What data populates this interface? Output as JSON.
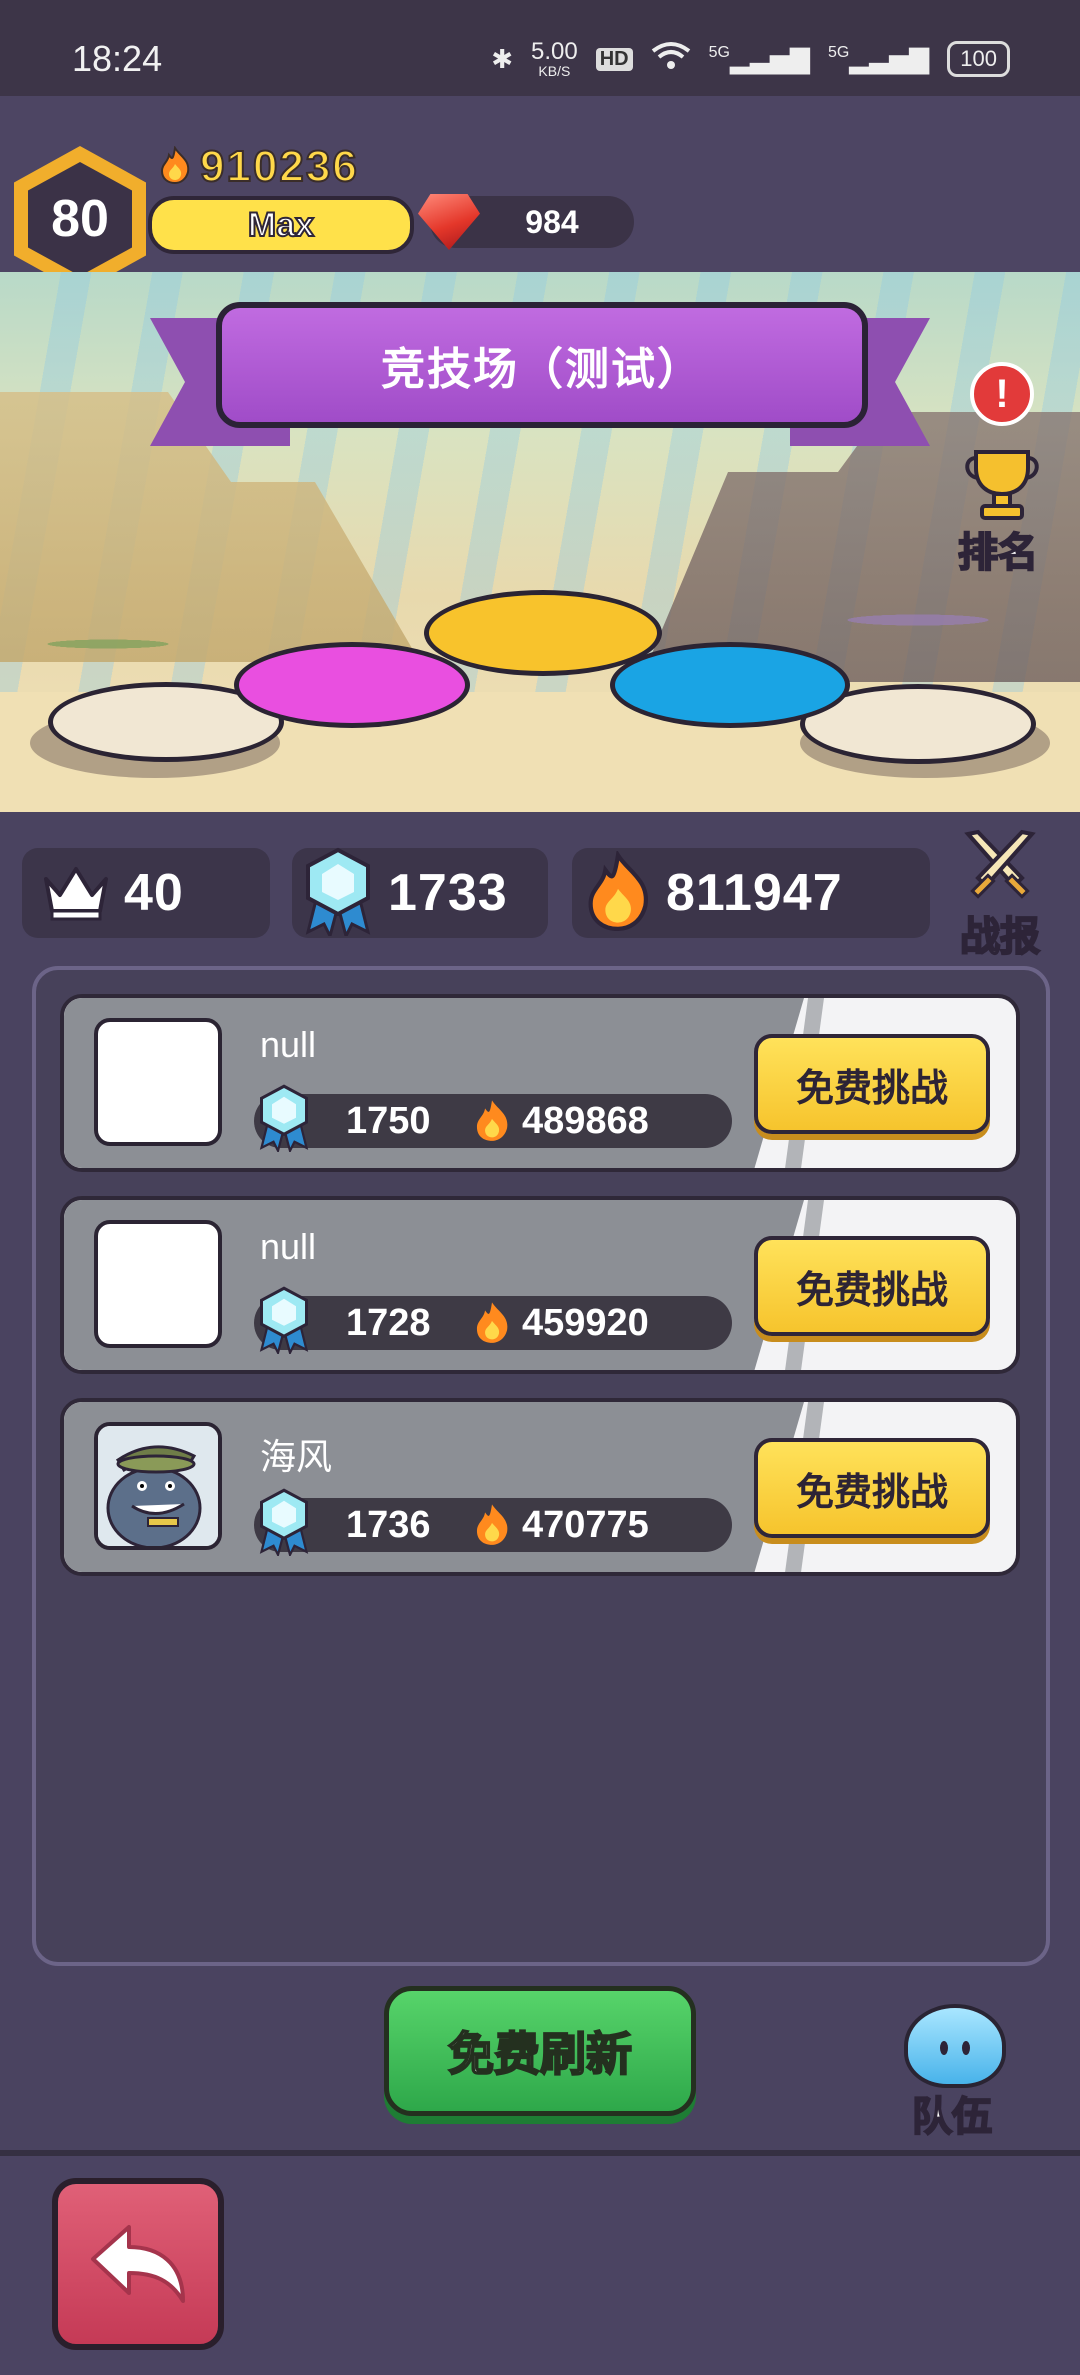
{
  "status_bar": {
    "time": "18:24",
    "net_speed": "5.00",
    "net_unit": "KB/S",
    "hd": "HD",
    "signal1": "5G",
    "signal2": "5G",
    "battery": "100"
  },
  "player": {
    "level": "80",
    "power": "910236",
    "xp_label": "Max",
    "gems": "984"
  },
  "arena": {
    "title": "竞技场（测试）",
    "alert": "!",
    "rank_label": "排名"
  },
  "stats": {
    "crowns": "40",
    "trophy_points": "1733",
    "power": "811947",
    "battle_report_label": "战报"
  },
  "opponents": [
    {
      "name": "null",
      "points": "1750",
      "power": "489868",
      "button": "免费挑战"
    },
    {
      "name": "null",
      "points": "1728",
      "power": "459920",
      "button": "免费挑战"
    },
    {
      "name": "海风",
      "points": "1736",
      "power": "470775",
      "button": "免费挑战"
    }
  ],
  "footer": {
    "refresh_label": "免费刷新",
    "team_label": "队伍"
  },
  "colors": {
    "gold": "#ffd84a",
    "challenge": "#f6c42d",
    "refresh": "#2ea84a",
    "back": "#c53a56",
    "banner": "#a04cc8"
  }
}
